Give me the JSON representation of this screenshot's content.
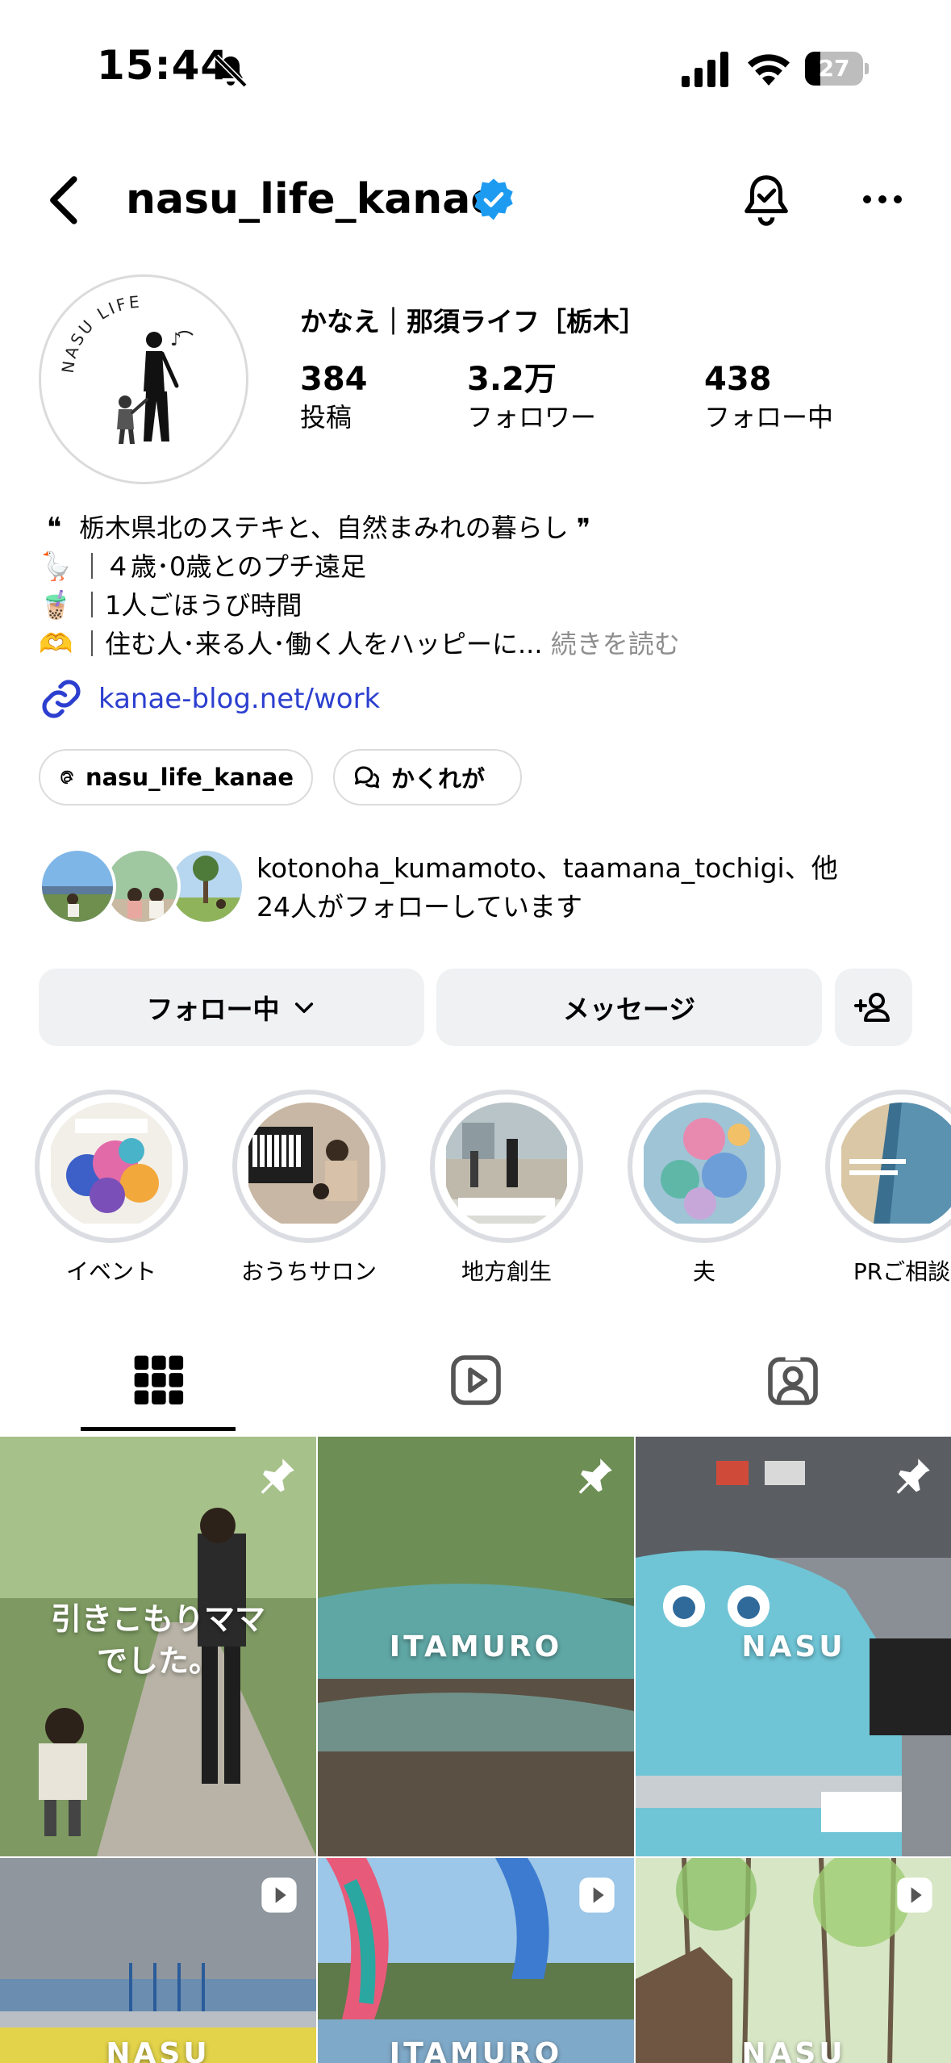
{
  "status_bar": {
    "time": "15:44",
    "battery": "27",
    "battery_level": 0.27
  },
  "header": {
    "username": "nasu_life_kanae"
  },
  "profile": {
    "avatar_text": "NASU LIFE",
    "display_name": "かなえ｜那須ライフ［栃木］",
    "stats": [
      {
        "value": "384",
        "label": "投稿"
      },
      {
        "value": "3.2万",
        "label": "フォロワー"
      },
      {
        "value": "438",
        "label": "フォロー中"
      }
    ]
  },
  "bio": {
    "lines": [
      {
        "emoji": "❝",
        "text": "栃木県北のステキと、自然まみれの暮らし ❞"
      },
      {
        "emoji": "🪿",
        "text": "｜４歳･0歳とのプチ遠足"
      },
      {
        "emoji": "🧋",
        "text": "｜1人ごほうび時間"
      },
      {
        "emoji": "🫶",
        "text": "｜住む人･来る人･働く人をハッピーに..."
      }
    ],
    "read_more": "続きを読む",
    "link": "kanae-blog.net/work"
  },
  "chips": {
    "threads": "nasu_life_kanae",
    "kakurega": "かくれが"
  },
  "mutual": {
    "line1": "kotonoha_kumamoto、taamana_tochigi、他",
    "line2": "24人がフォローしています"
  },
  "actions": {
    "following": "フォロー中",
    "message": "メッセージ"
  },
  "highlights": [
    {
      "label": "イベント"
    },
    {
      "label": "おうちサロン"
    },
    {
      "label": "地方創生"
    },
    {
      "label": "夫"
    },
    {
      "label": "PRご相談"
    }
  ],
  "grid": {
    "posts": [
      {
        "caption": "引きこもりママ\nでした。"
      },
      {
        "caption": "ITAMURO"
      },
      {
        "caption": "NASU"
      },
      {
        "caption": "NASU"
      },
      {
        "caption": "ITAMURO"
      },
      {
        "caption": "NASU"
      }
    ]
  },
  "colors": {
    "link": "#2c3fcf",
    "verified": "#1d9bf0",
    "button_bg": "#eff1f3"
  }
}
